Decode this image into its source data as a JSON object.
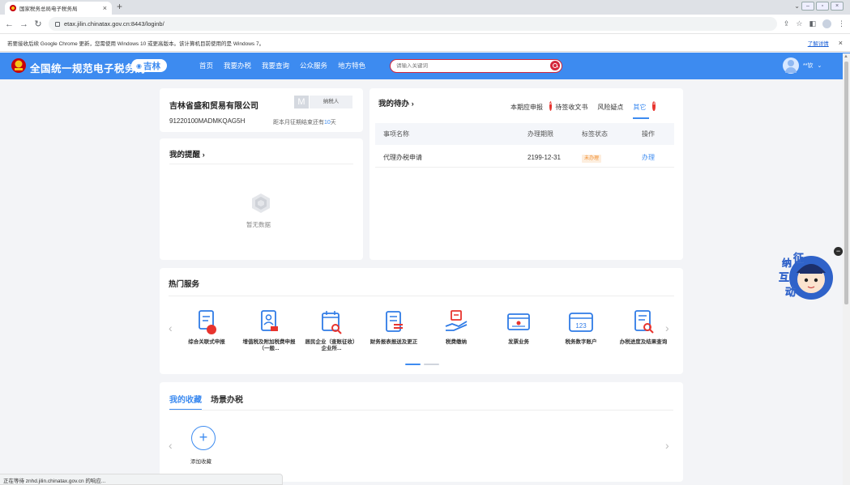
{
  "browser": {
    "tab_title": "国家税务总局电子税务局",
    "tab_close": "×",
    "new_tab": "+",
    "url": "etax.jilin.chinatax.gov.cn:8443/loginb/",
    "infobar_text": "若要接收后续 Google Chrome 更新，您需使用 Windows 10 或更高版本。该计算机目前使用的是 Windows 7。",
    "infobar_link": "了解详情",
    "infobar_close": "×",
    "status_text": "正在等待 znhd.jilin.chinatax.gov.cn 的响应..."
  },
  "header": {
    "site_title": "全国统一规范电子税务局",
    "region": "吉林",
    "nav": [
      "首页",
      "我要办税",
      "我要查询",
      "公众服务",
      "地方特色"
    ],
    "search_placeholder": "请输入关键词",
    "user_name": "**钦",
    "user_caret": "⌄"
  },
  "company": {
    "name": "吉林省盛和贸易有限公司",
    "badge_letter": "M",
    "taxpayer_type": "纳税人",
    "tax_id": "91220100MADMKQAG5H",
    "deadline_prefix": "距本月征期结束还有",
    "deadline_days": "10",
    "deadline_suffix": "天"
  },
  "reminder": {
    "title": "我的提醒",
    "title_arrow": "›",
    "empty_text": "暂无数据"
  },
  "todo": {
    "title": "我的待办",
    "title_arrow": "›",
    "tabs": [
      {
        "label": "本期应申报",
        "badge": "2"
      },
      {
        "label": "待签收文书",
        "badge": ""
      },
      {
        "label": "风险疑点",
        "badge": ""
      },
      {
        "label": "其它",
        "badge": "1"
      }
    ],
    "active_tab": "其它",
    "columns": [
      "事项名称",
      "办理期限",
      "标签状态",
      "操作"
    ],
    "rows": [
      {
        "name": "代理办税申请",
        "deadline": "2199-12-31",
        "status": "未办理",
        "action": "办理"
      }
    ]
  },
  "hot_services": {
    "title": "热门服务",
    "prev": "‹",
    "next": "›",
    "items": [
      {
        "label": "综合关联式申报",
        "icon": "report-icon"
      },
      {
        "label": "增值税及附加税费申报（一般...",
        "icon": "person-doc-icon"
      },
      {
        "label": "居民企业（查账征收）企业所...",
        "icon": "calendar-search-icon"
      },
      {
        "label": "财务报表报送及更正",
        "icon": "finance-report-icon"
      },
      {
        "label": "税费缴纳",
        "icon": "tax-payment-icon"
      },
      {
        "label": "发票业务",
        "icon": "invoice-icon"
      },
      {
        "label": "税务数字账户",
        "icon": "digital-account-icon"
      },
      {
        "label": "办税进度及结果查询",
        "icon": "progress-query-icon"
      }
    ]
  },
  "favorites": {
    "tabs": [
      "我的收藏",
      "场景办税"
    ],
    "active_tab": "我的收藏",
    "add_symbol": "+",
    "add_label": "添加收藏",
    "prev": "‹",
    "next": "›"
  },
  "helper": {
    "chars": [
      "纳",
      "征",
      "互",
      "动"
    ],
    "close": "−"
  },
  "colors": {
    "brand_blue": "#3d8bf0",
    "search_red": "#d4283b",
    "badge_red": "#e8342e",
    "status_orange": "#f08b2b"
  }
}
